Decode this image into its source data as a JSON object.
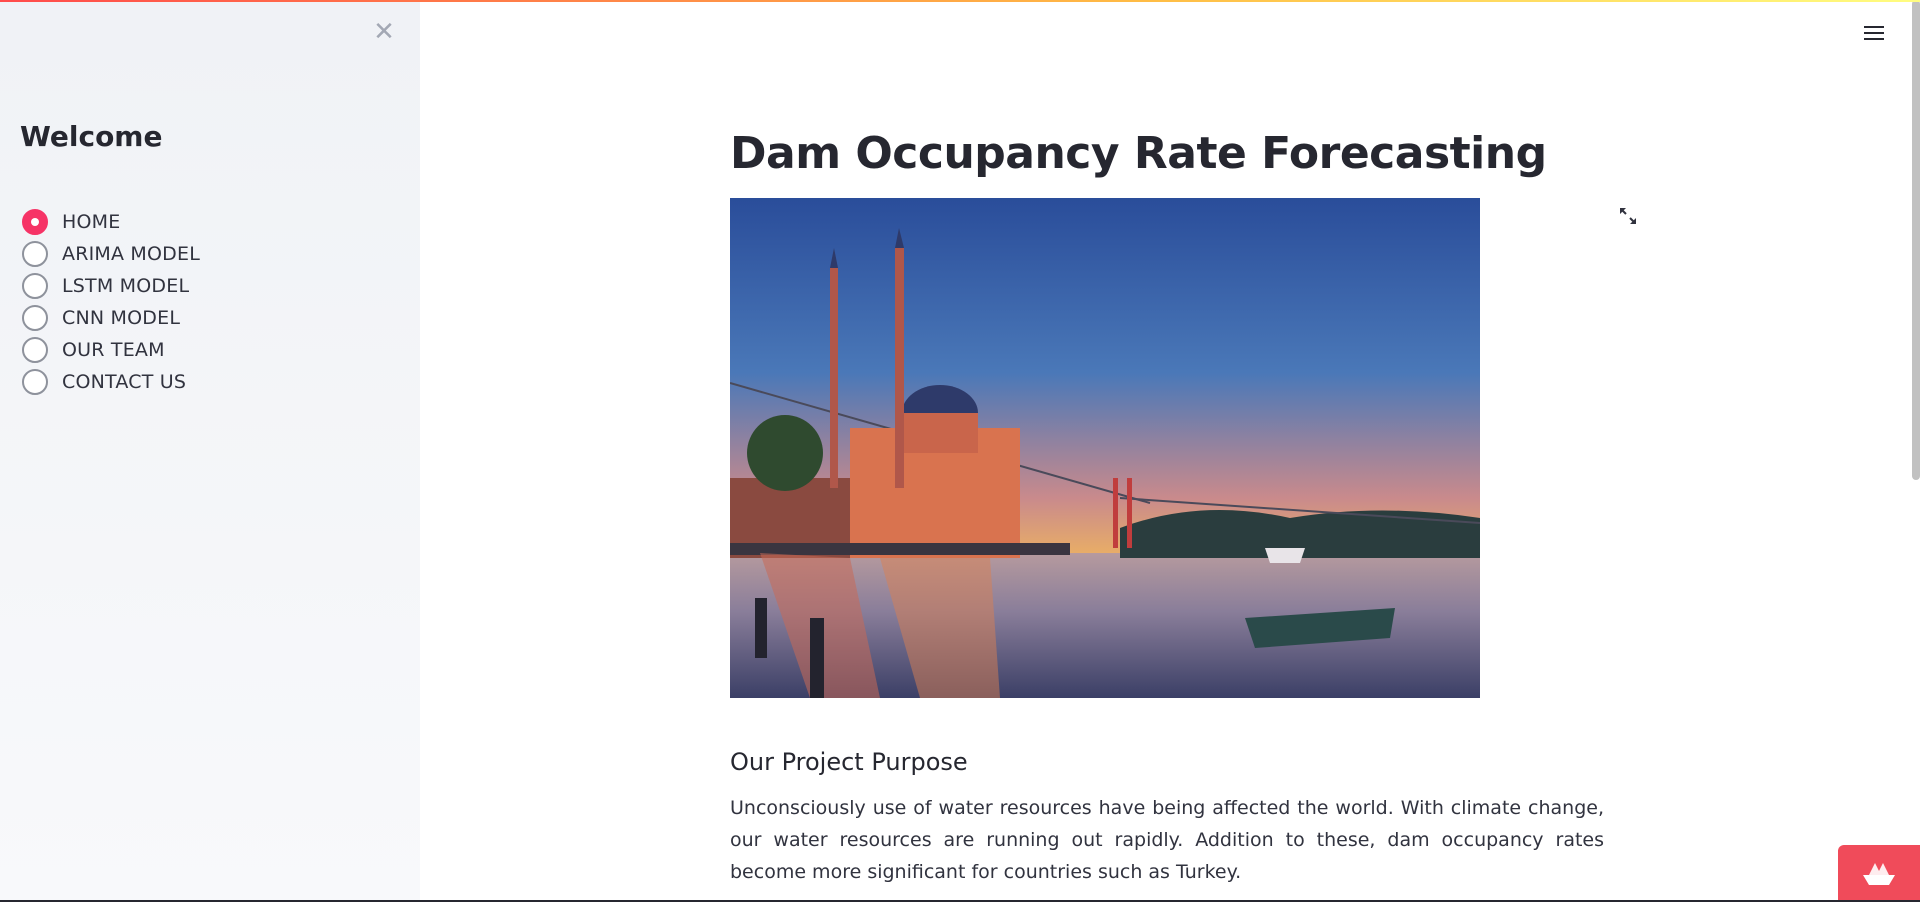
{
  "sidebar": {
    "title": "Welcome",
    "close_icon": "close-icon",
    "items": [
      {
        "label": "HOME",
        "selected": true
      },
      {
        "label": "ARIMA MODEL",
        "selected": false
      },
      {
        "label": "LSTM MODEL",
        "selected": false
      },
      {
        "label": "CNN MODEL",
        "selected": false
      },
      {
        "label": "OUR TEAM",
        "selected": false
      },
      {
        "label": "CONTACT US",
        "selected": false
      }
    ]
  },
  "header": {
    "menu_icon": "hamburger-menu-icon"
  },
  "main": {
    "title": "Dam Occupancy Rate Forecasting",
    "image_icon": "fullscreen-expand-icon",
    "section_heading": "Our Project Purpose",
    "paragraph": "Unconsciously use of water resources have being affected the world. With climate change, our water resources are running out rapidly. Addition to these, dam occupancy rates become more significant for countries such as Turkey."
  },
  "colors": {
    "accent": "#f63366",
    "sidebar_bg": "#f0f2f6",
    "text": "#262730",
    "badge": "#f04b5a"
  }
}
